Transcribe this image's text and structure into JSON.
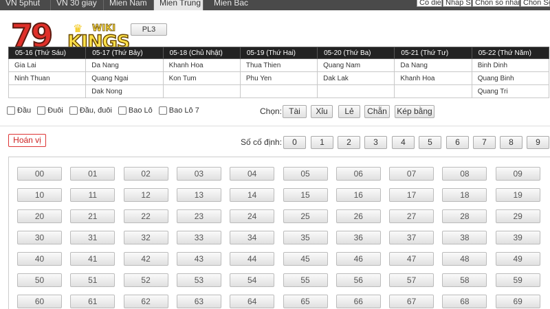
{
  "tabs": [
    "VN 5phut",
    "VN 30 giay",
    "Mien Nam",
    "Mien Trung",
    "Mien Bac"
  ],
  "active_tab": "Mien Trung",
  "right_tabs": [
    "Co dien",
    "Nhap So",
    "Chon so nhanh",
    "Chon So"
  ],
  "logo": {
    "text_79": "79",
    "text_kings": "KINGS",
    "text_wiki": "WIKI"
  },
  "pl3_label": "PL3",
  "schedule": {
    "headers": [
      "05-16 (Thứ Sáu)",
      "05-17 (Thứ Bảy)",
      "05-18 (Chủ Nhật)",
      "05-19 (Thứ Hai)",
      "05-20 (Thứ Ba)",
      "05-21 (Thứ Tư)",
      "05-22 (Thứ Năm)"
    ],
    "rows": [
      [
        "Gia Lai",
        "Da Nang",
        "Khanh Hoa",
        "Thua Thien",
        "Quang Nam",
        "Da Nang",
        "Binh Dinh"
      ],
      [
        "Ninh Thuan",
        "Quang Ngai",
        "Kon Tum",
        "Phu Yen",
        "Dak Lak",
        "Khanh Hoa",
        "Quang Binh"
      ],
      [
        "",
        "Dak Nong",
        "",
        "",
        "",
        "",
        "Quang Tri"
      ]
    ]
  },
  "options": [
    "Đầu",
    "Đuôi",
    "Đầu, đuôi",
    "Bao Lô",
    "Bao Lô 7"
  ],
  "chon": {
    "label": "Chọn:",
    "buttons": [
      "Tài",
      "Xỉu",
      "Lẻ",
      "Chẵn",
      "Kép bằng"
    ]
  },
  "hoan_vi_label": "Hoán vị",
  "so_co_dinh": {
    "label": "Số cố định:",
    "digits": [
      "0",
      "1",
      "2",
      "3",
      "4",
      "5",
      "6",
      "7",
      "8",
      "9"
    ]
  },
  "numbers": [
    "00",
    "01",
    "02",
    "03",
    "04",
    "05",
    "06",
    "07",
    "08",
    "09",
    "10",
    "11",
    "12",
    "13",
    "14",
    "15",
    "16",
    "17",
    "18",
    "19",
    "20",
    "21",
    "22",
    "23",
    "24",
    "25",
    "26",
    "27",
    "28",
    "29",
    "30",
    "31",
    "32",
    "33",
    "34",
    "35",
    "36",
    "37",
    "38",
    "39",
    "40",
    "41",
    "42",
    "43",
    "44",
    "45",
    "46",
    "47",
    "48",
    "49",
    "50",
    "51",
    "52",
    "53",
    "54",
    "55",
    "56",
    "57",
    "58",
    "59",
    "60",
    "61",
    "62",
    "63",
    "64",
    "65",
    "66",
    "67",
    "68",
    "69"
  ],
  "colors": {
    "topbar": "#4a4a4a",
    "table_header": "#222222",
    "accent_red": "#cc2222"
  }
}
